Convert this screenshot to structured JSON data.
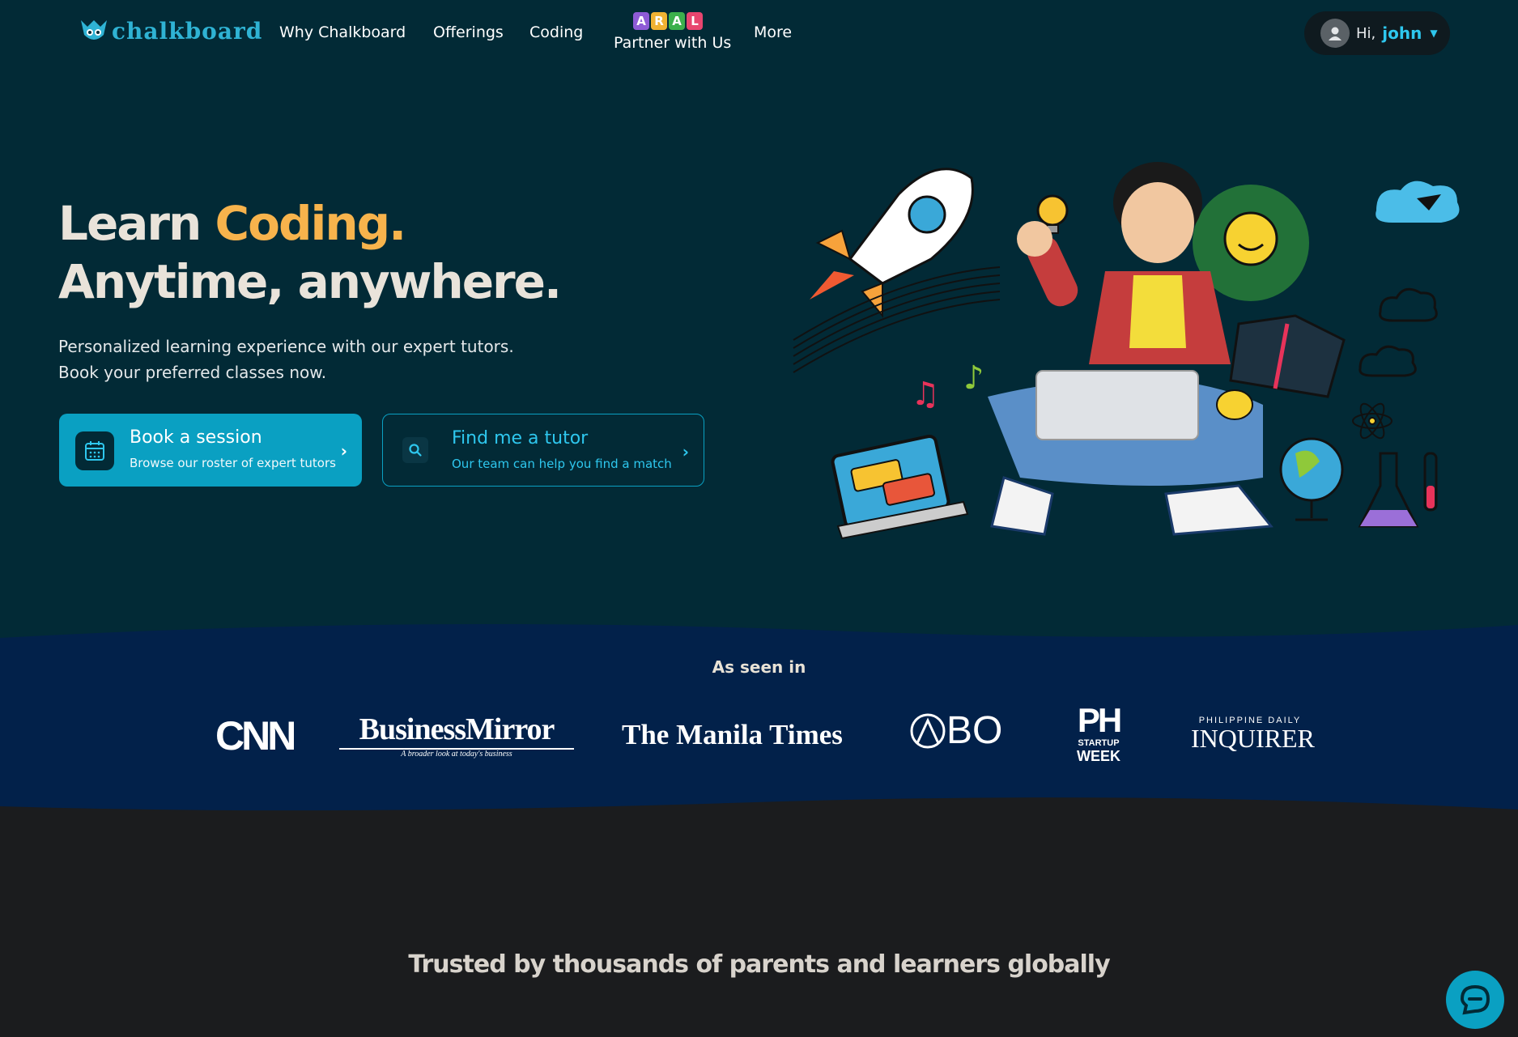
{
  "nav": {
    "logo_text": "chalkboard",
    "links": [
      "Why Chalkboard",
      "Offerings",
      "Coding",
      "Partner with Us",
      "More"
    ],
    "aral_letters": [
      "A",
      "R",
      "A",
      "L"
    ],
    "user_greeting": "Hi,",
    "user_name": "john"
  },
  "hero": {
    "headline_1": "Learn",
    "headline_accent": "Coding.",
    "headline_2": "Anytime, anywhere.",
    "sub_1": "Personalized learning experience with our expert tutors.",
    "sub_2": "Book your preferred classes now.",
    "book_title": "Book a session",
    "book_desc": "Browse our roster of expert tutors",
    "find_title": "Find me a tutor",
    "find_desc": "Our team can help you find a match"
  },
  "press": {
    "title": "As seen in",
    "logos": [
      "CNN",
      "BusinessMirror",
      "A broader look at today's business",
      "The Manila Times",
      "BO",
      "PH",
      "STARTUP",
      "WEEK",
      "PHILIPPINE DAILY",
      "INQUIRER"
    ]
  },
  "trusted": {
    "title": "Trusted by thousands of parents and learners globally"
  },
  "colors": {
    "hero_bg": "#022a36",
    "press_bg": "#02214a",
    "accent_orange": "#f7b34c",
    "accent_cyan": "#0aa0c2",
    "dark_bg": "#1b1c1e"
  },
  "icons": [
    "chalkboard-logo-icon",
    "user-avatar-icon",
    "caret-down-icon",
    "calendar-icon",
    "search-icon",
    "chevron-right-icon",
    "chat-icon"
  ]
}
